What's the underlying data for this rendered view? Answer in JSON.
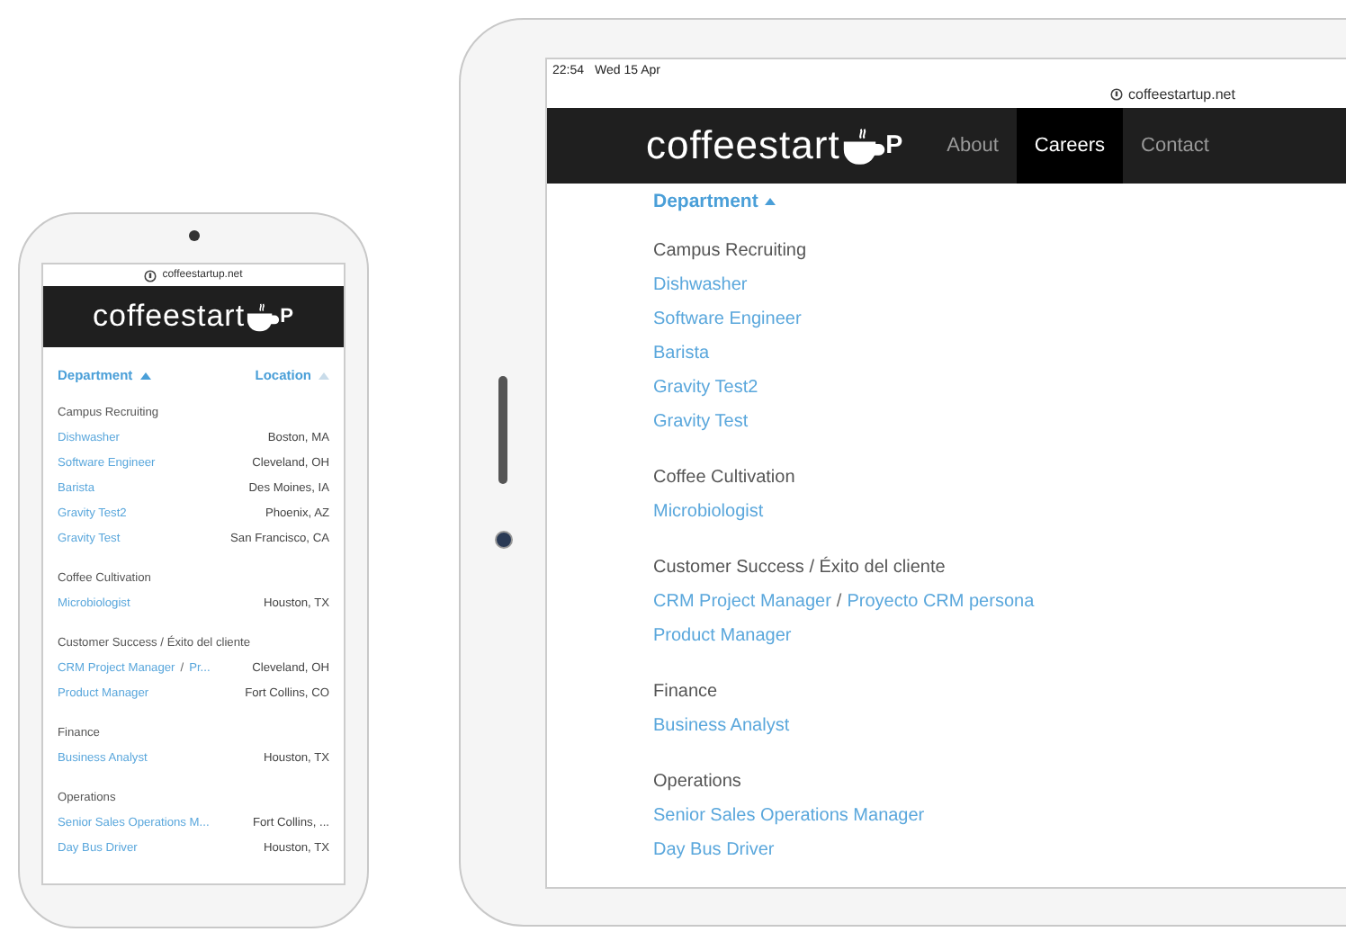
{
  "phone": {
    "url": "coffeestartup.net",
    "logo": {
      "text": "coffeestart",
      "suffix": "P"
    },
    "headers": [
      {
        "label": "Department",
        "sort_active": true
      },
      {
        "label": "Location",
        "sort_active": false
      }
    ],
    "groups": [
      {
        "name": "Campus Recruiting",
        "jobs": [
          {
            "titles": [
              "Dishwasher"
            ],
            "location": "Boston, MA"
          },
          {
            "titles": [
              "Software Engineer"
            ],
            "location": "Cleveland, OH"
          },
          {
            "titles": [
              "Barista"
            ],
            "location": "Des Moines, IA"
          },
          {
            "titles": [
              "Gravity Test2"
            ],
            "location": "Phoenix, AZ"
          },
          {
            "titles": [
              "Gravity Test"
            ],
            "location": "San Francisco, CA"
          }
        ]
      },
      {
        "name": "Coffee Cultivation",
        "jobs": [
          {
            "titles": [
              "Microbiologist"
            ],
            "location": "Houston, TX"
          }
        ]
      },
      {
        "name": "Customer Success / Éxito del cliente",
        "jobs": [
          {
            "titles": [
              "CRM Project Manager",
              "Pr..."
            ],
            "separator": "/",
            "location": "Cleveland, OH"
          },
          {
            "titles": [
              "Product Manager"
            ],
            "location": "Fort Collins, CO"
          }
        ]
      },
      {
        "name": "Finance",
        "jobs": [
          {
            "titles": [
              "Business Analyst"
            ],
            "location": "Houston, TX"
          }
        ]
      },
      {
        "name": "Operations",
        "jobs": [
          {
            "titles": [
              "Senior Sales Operations M..."
            ],
            "location": "Fort Collins, ..."
          },
          {
            "titles": [
              "Day Bus Driver"
            ],
            "location": "Houston, TX"
          }
        ]
      }
    ]
  },
  "tablet": {
    "time": "22:54",
    "date": "Wed 15 Apr",
    "url": "coffeestartup.net",
    "logo": {
      "text": "coffeestart",
      "suffix": "P"
    },
    "nav": [
      {
        "label": "About",
        "selected": false
      },
      {
        "label": "Careers",
        "selected": true
      },
      {
        "label": "Contact",
        "selected": false
      }
    ],
    "header": {
      "label": "Department",
      "sort_active": true
    },
    "groups": [
      {
        "name": "Campus Recruiting",
        "jobs": [
          {
            "titles": [
              "Dishwasher"
            ]
          },
          {
            "titles": [
              "Software Engineer"
            ]
          },
          {
            "titles": [
              "Barista"
            ]
          },
          {
            "titles": [
              "Gravity Test2"
            ]
          },
          {
            "titles": [
              "Gravity Test"
            ]
          }
        ]
      },
      {
        "name": "Coffee Cultivation",
        "jobs": [
          {
            "titles": [
              "Microbiologist"
            ]
          }
        ]
      },
      {
        "name": "Customer Success / Éxito del cliente",
        "jobs": [
          {
            "titles": [
              "CRM Project Manager",
              "Proyecto CRM persona"
            ],
            "separator": "/"
          },
          {
            "titles": [
              "Product Manager"
            ]
          }
        ]
      },
      {
        "name": "Finance",
        "jobs": [
          {
            "titles": [
              "Business Analyst"
            ]
          }
        ]
      },
      {
        "name": "Operations",
        "jobs": [
          {
            "titles": [
              "Senior Sales Operations Manager"
            ]
          },
          {
            "titles": [
              "Day Bus Driver"
            ]
          }
        ]
      }
    ]
  }
}
